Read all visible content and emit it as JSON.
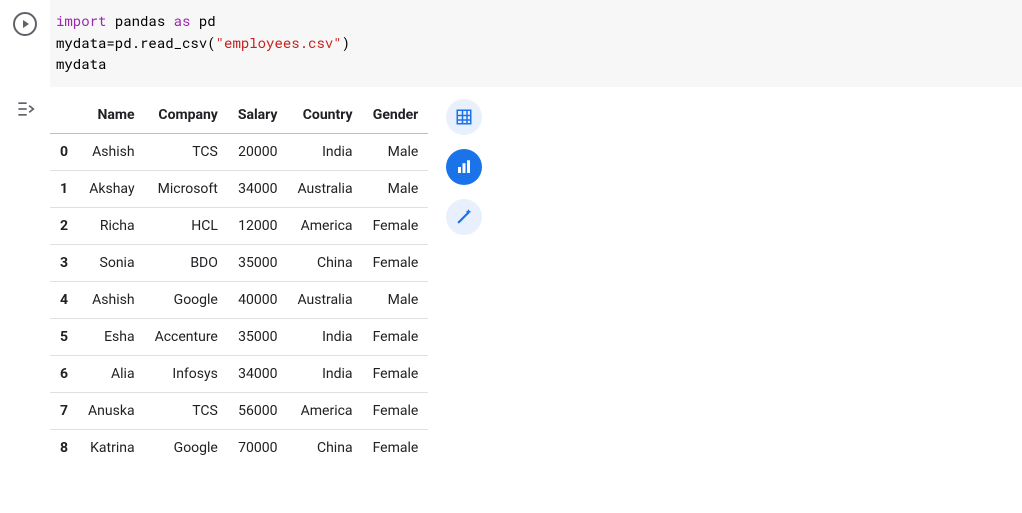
{
  "code": {
    "line1_import": "import",
    "line1_pandas": "pandas",
    "line1_as": "as",
    "line1_pd": "pd",
    "line2_prefix": "mydata=pd.read_csv(",
    "line2_str": "\"employees.csv\"",
    "line2_suffix": ")",
    "line3": "mydata"
  },
  "table": {
    "columns": [
      "Name",
      "Company",
      "Salary",
      "Country",
      "Gender"
    ],
    "rows": [
      {
        "idx": "0",
        "Name": "Ashish",
        "Company": "TCS",
        "Salary": "20000",
        "Country": "India",
        "Gender": "Male"
      },
      {
        "idx": "1",
        "Name": "Akshay",
        "Company": "Microsoft",
        "Salary": "34000",
        "Country": "Australia",
        "Gender": "Male"
      },
      {
        "idx": "2",
        "Name": "Richa",
        "Company": "HCL",
        "Salary": "12000",
        "Country": "America",
        "Gender": "Female"
      },
      {
        "idx": "3",
        "Name": "Sonia",
        "Company": "BDO",
        "Salary": "35000",
        "Country": "China",
        "Gender": "Female"
      },
      {
        "idx": "4",
        "Name": "Ashish",
        "Company": "Google",
        "Salary": "40000",
        "Country": "Australia",
        "Gender": "Male"
      },
      {
        "idx": "5",
        "Name": "Esha",
        "Company": "Accenture",
        "Salary": "35000",
        "Country": "India",
        "Gender": "Female"
      },
      {
        "idx": "6",
        "Name": "Alia",
        "Company": "Infosys",
        "Salary": "34000",
        "Country": "India",
        "Gender": "Female"
      },
      {
        "idx": "7",
        "Name": "Anuska",
        "Company": "TCS",
        "Salary": "56000",
        "Country": "America",
        "Gender": "Female"
      },
      {
        "idx": "8",
        "Name": "Katrina",
        "Company": "Google",
        "Salary": "70000",
        "Country": "China",
        "Gender": "Female"
      }
    ]
  },
  "tools": {
    "table_view": "table-view",
    "chart_view": "chart-view",
    "magic_view": "magic-suggest"
  },
  "chart_data": {
    "type": "table",
    "title": "",
    "columns": [
      "Name",
      "Company",
      "Salary",
      "Country",
      "Gender"
    ],
    "index": [
      0,
      1,
      2,
      3,
      4,
      5,
      6,
      7,
      8
    ],
    "rows": [
      [
        "Ashish",
        "TCS",
        20000,
        "India",
        "Male"
      ],
      [
        "Akshay",
        "Microsoft",
        34000,
        "Australia",
        "Male"
      ],
      [
        "Richa",
        "HCL",
        12000,
        "America",
        "Female"
      ],
      [
        "Sonia",
        "BDO",
        35000,
        "China",
        "Female"
      ],
      [
        "Ashish",
        "Google",
        40000,
        "Australia",
        "Male"
      ],
      [
        "Esha",
        "Accenture",
        35000,
        "India",
        "Female"
      ],
      [
        "Alia",
        "Infosys",
        34000,
        "India",
        "Female"
      ],
      [
        "Anuska",
        "TCS",
        56000,
        "America",
        "Female"
      ],
      [
        "Katrina",
        "Google",
        70000,
        "China",
        "Female"
      ]
    ]
  }
}
